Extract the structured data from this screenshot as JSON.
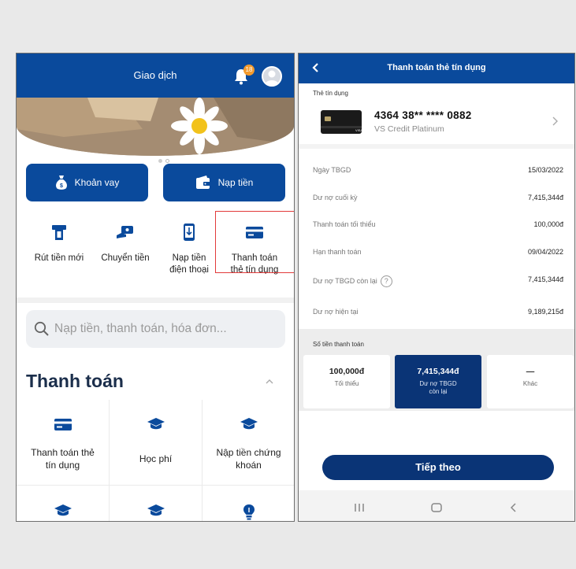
{
  "left": {
    "header": {
      "title": "Giao dịch",
      "notification_count": "18"
    },
    "actions": {
      "loan": "Khoản vay",
      "topup": "Nạp tiền"
    },
    "services": [
      {
        "label": "Rút tiền mới",
        "icon": "atm-withdraw-icon"
      },
      {
        "label": "Chuyển tiền",
        "icon": "money-transfer-icon"
      },
      {
        "label": "Nạp tiền\nđiện thoại",
        "icon": "phone-topup-icon"
      },
      {
        "label": "Thanh toán\nthẻ tín dụng",
        "icon": "credit-card-icon"
      }
    ],
    "search": {
      "placeholder": "Nạp tiền, thanh toán, hóa đơn..."
    },
    "section_title": "Thanh toán",
    "tiles": [
      {
        "label": "Thanh toán thẻ\ntín dụng",
        "icon": "credit-card-icon"
      },
      {
        "label": "Học phí",
        "icon": "graduation-cap-icon"
      },
      {
        "label": "Nập tiền chứng\nkhoán",
        "icon": "graduation-cap-icon"
      }
    ],
    "tiles_row2_icons": [
      "graduation-cap-icon",
      "graduation-cap-icon",
      "lightbulb-icon"
    ]
  },
  "right": {
    "header": {
      "title": "Thanh toán thẻ tín dụng"
    },
    "card_section_label": "Thẻ tín dụng",
    "card": {
      "number": "4364 38** **** 0882",
      "name": "VS Credit Platinum"
    },
    "info": [
      {
        "key": "Ngày TBGD",
        "value": "15/03/2022"
      },
      {
        "key": "Dư nợ cuối kỳ",
        "value": "7,415,344đ"
      },
      {
        "key": "Thanh toán tối thiểu",
        "value": "100,000đ"
      },
      {
        "key": "Hạn thanh toán",
        "value": "09/04/2022"
      },
      {
        "key": "Dư nợ TBGD còn lại",
        "value": "7,415,344đ"
      },
      {
        "key": "Dư nợ hiện tại",
        "value": "9,189,215đ"
      }
    ],
    "payment_label": "Số tiền thanh toán",
    "options": [
      {
        "amount": "100,000đ",
        "caption": "Tối thiểu"
      },
      {
        "amount": "7,415,344đ",
        "caption": "Dư nợ TBGD\ncòn lại"
      },
      {
        "amount": "—",
        "caption": "Khác"
      }
    ],
    "next_button": "Tiếp theo"
  },
  "colors": {
    "primary": "#0a4a9c",
    "dark_navy": "#0a3476",
    "highlight_red": "#e23a3a",
    "badge_orange": "#f39a2c"
  }
}
